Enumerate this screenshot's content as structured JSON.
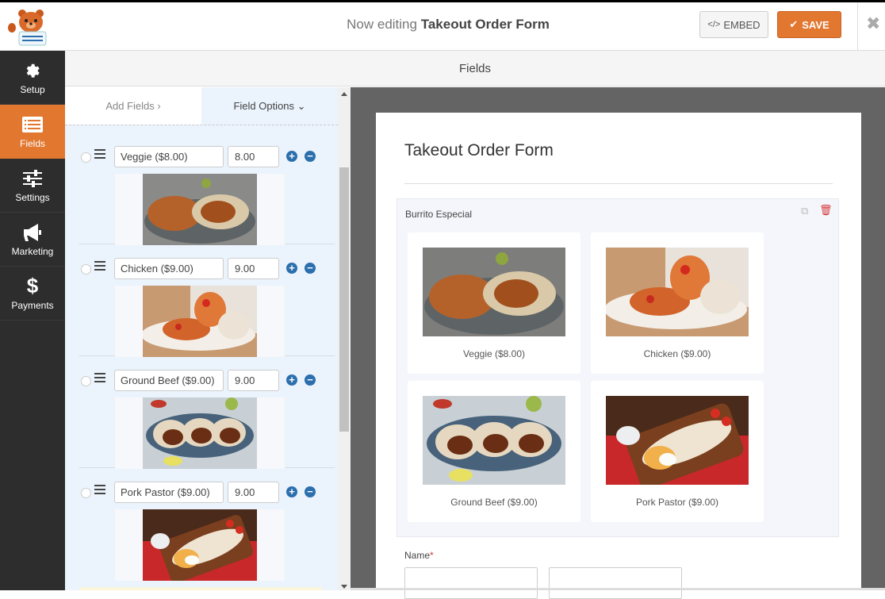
{
  "header": {
    "title_prefix": "Now editing",
    "form_name": "Takeout Order Form",
    "embed_label": "EMBED",
    "save_label": "SAVE",
    "close_symbol": "✖"
  },
  "sidebar": {
    "items": [
      {
        "label": "Setup",
        "icon": "gear-icon",
        "active": false
      },
      {
        "label": "Fields",
        "icon": "fields-list-icon",
        "active": true
      },
      {
        "label": "Settings",
        "icon": "sliders-icon",
        "active": false
      },
      {
        "label": "Marketing",
        "icon": "megaphone-icon",
        "active": false
      },
      {
        "label": "Payments",
        "icon": "dollar-icon",
        "active": false
      }
    ]
  },
  "section_bar": {
    "title": "Fields"
  },
  "panel": {
    "tabs": [
      {
        "label": "Add Fields ›",
        "active": false
      },
      {
        "label": "Field Options ⌄",
        "active": true
      }
    ],
    "choices": [
      {
        "label": "Veggie ($8.00)",
        "value": "8.00",
        "image": "veggie-burrito"
      },
      {
        "label": "Chicken ($9.00)",
        "value": "9.00",
        "image": "chicken-burrito"
      },
      {
        "label": "Ground Beef ($9.00)",
        "value": "9.00",
        "image": "ground-beef-burrito"
      },
      {
        "label": "Pork Pastor ($9.00)",
        "value": "9.00",
        "image": "pork-pastor-burrito"
      }
    ]
  },
  "preview": {
    "form_title": "Takeout Order Form",
    "field_label": "Burrito Especial",
    "options": [
      {
        "caption": "Veggie ($8.00)"
      },
      {
        "caption": "Chicken ($9.00)"
      },
      {
        "caption": "Ground Beef ($9.00)"
      },
      {
        "caption": "Pork Pastor ($9.00)"
      }
    ],
    "name_label": "Name",
    "required_mark": "*"
  }
}
